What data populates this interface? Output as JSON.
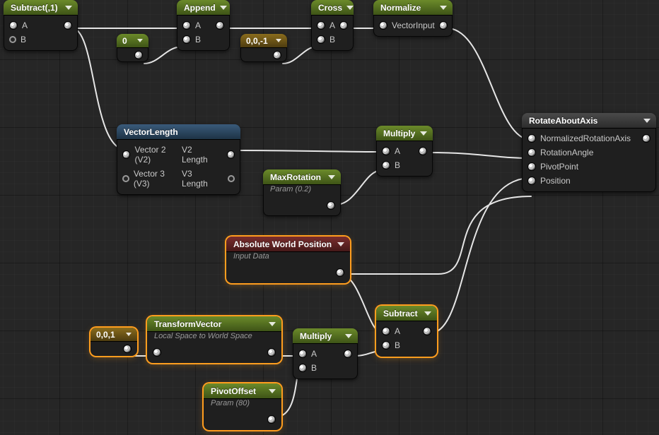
{
  "pins": {
    "A": "A",
    "B": "B"
  },
  "nodes": {
    "subtract1": {
      "title": "Subtract(,1)",
      "pins": [
        "A",
        "B"
      ]
    },
    "append": {
      "title": "Append",
      "pins": [
        "A",
        "B"
      ]
    },
    "cross": {
      "title": "Cross",
      "pins": [
        "A",
        "B"
      ]
    },
    "normalize": {
      "title": "Normalize",
      "pin": "VectorInput"
    },
    "const0": {
      "value": "0"
    },
    "const001n": {
      "value": "0,0,-1"
    },
    "vectorlen": {
      "title": "VectorLength",
      "pin1_label": "Vector 2 (V2)",
      "pin1_out": "V2 Length",
      "pin2_label": "Vector 3 (V3)",
      "pin2_out": "V3 Length"
    },
    "multiply1": {
      "title": "Multiply",
      "pins": [
        "A",
        "B"
      ]
    },
    "maxrot": {
      "title": "MaxRotation",
      "subtitle": "Param (0.2)"
    },
    "rotate": {
      "title": "RotateAboutAxis",
      "pins": [
        "NormalizedRotationAxis",
        "RotationAngle",
        "PivotPoint",
        "Position"
      ]
    },
    "awp": {
      "title": "Absolute World Position",
      "subtitle": "Input Data"
    },
    "transform": {
      "title": "TransformVector",
      "subtitle": "Local Space to World Space"
    },
    "const001": {
      "value": "0,0,1"
    },
    "multiply2": {
      "title": "Multiply",
      "pins": [
        "A",
        "B"
      ]
    },
    "subtract2": {
      "title": "Subtract",
      "pins": [
        "A",
        "B"
      ]
    },
    "pivotoff": {
      "title": "PivotOffset",
      "subtitle": "Param (80)"
    }
  }
}
